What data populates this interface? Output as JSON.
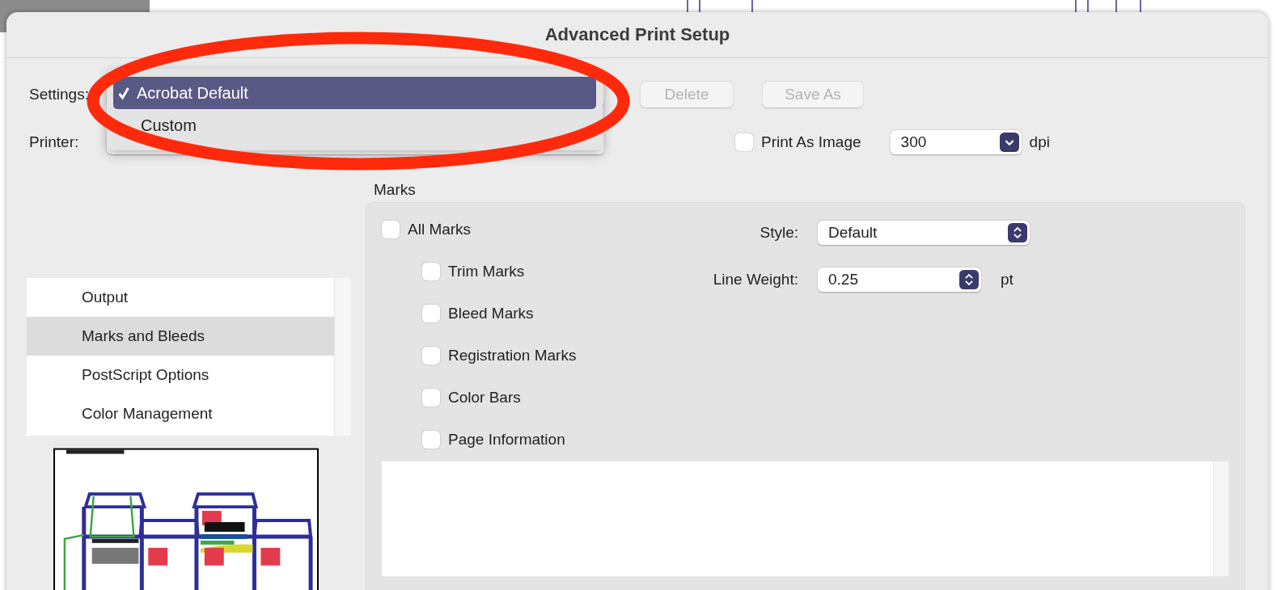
{
  "window": {
    "title": "Advanced Print Setup"
  },
  "settings": {
    "label": "Settings:",
    "menu": [
      {
        "label": "Acrobat Default",
        "selected": true
      },
      {
        "label": "Custom",
        "selected": false
      }
    ]
  },
  "buttons": [
    {
      "label": "Delete",
      "disabled": true
    },
    {
      "label": "Save As",
      "disabled": true
    }
  ],
  "printer": {
    "label": "Printer:"
  },
  "print_as_image": {
    "label": "Print As Image",
    "checked": false
  },
  "resolution": {
    "value": "300",
    "unit": "dpi"
  },
  "sections": [
    {
      "label": "Output",
      "selected": false
    },
    {
      "label": "Marks and Bleeds",
      "selected": true
    },
    {
      "label": "PostScript Options",
      "selected": false
    },
    {
      "label": "Color Management",
      "selected": false
    }
  ],
  "marks": {
    "title": "Marks",
    "all_marks": {
      "label": "All Marks",
      "checked": false
    },
    "options": [
      {
        "label": "Trim Marks",
        "checked": false
      },
      {
        "label": "Bleed Marks",
        "checked": false
      },
      {
        "label": "Registration Marks",
        "checked": false
      },
      {
        "label": "Color Bars",
        "checked": false
      },
      {
        "label": "Page Information",
        "checked": false
      }
    ],
    "style": {
      "label": "Style:",
      "value": "Default"
    },
    "line_weight": {
      "label": "Line Weight:",
      "value": "0.25",
      "unit": "pt"
    }
  }
}
